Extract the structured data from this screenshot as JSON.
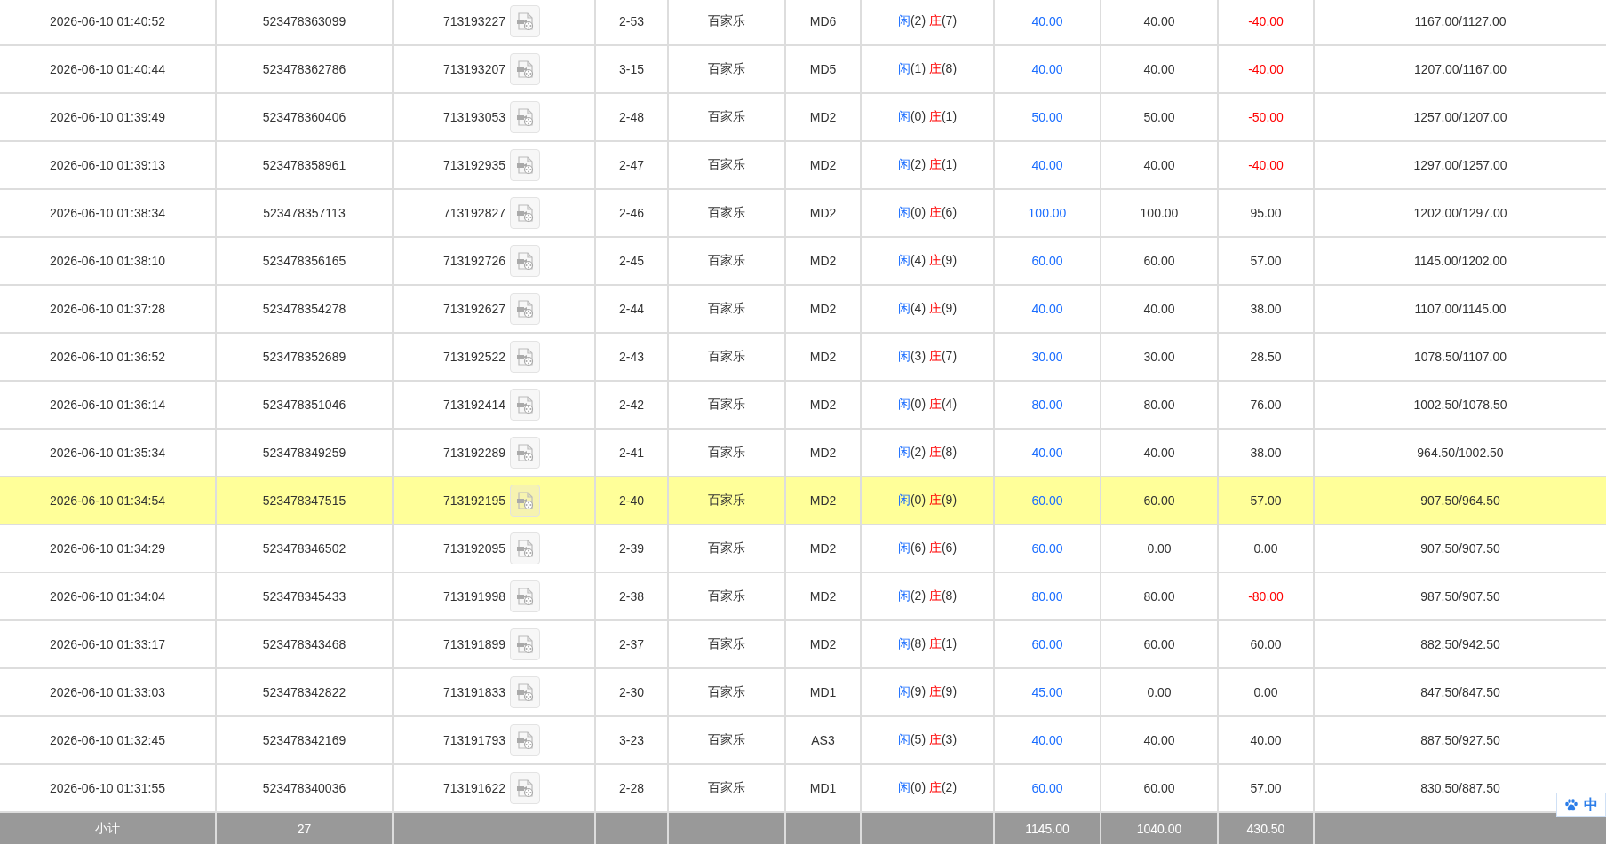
{
  "table": {
    "rows": [
      {
        "selected": false,
        "column_1": "2026-06-10 01:40:52",
        "column_2": "523478363099",
        "column_3": "713193227",
        "column_4": "2-53",
        "column_5": "百家乐",
        "column_6": "MD6",
        "column_7": {
          "player": "闲",
          "player_points": "(2)",
          "banker": "庄",
          "banker_points": "(7)"
        },
        "column_8": "40.00",
        "column_9": "40.00",
        "column_10": "-40.00",
        "column_10_negative": true,
        "column_11": "1167.00/1127.00"
      },
      {
        "selected": false,
        "column_1": "2026-06-10 01:40:44",
        "column_2": "523478362786",
        "column_3": "713193207",
        "column_4": "3-15",
        "column_5": "百家乐",
        "column_6": "MD5",
        "column_7": {
          "player": "闲",
          "player_points": "(1)",
          "banker": "庄",
          "banker_points": "(8)"
        },
        "column_8": "40.00",
        "column_9": "40.00",
        "column_10": "-40.00",
        "column_10_negative": true,
        "column_11": "1207.00/1167.00"
      },
      {
        "selected": false,
        "column_1": "2026-06-10 01:39:49",
        "column_2": "523478360406",
        "column_3": "713193053",
        "column_4": "2-48",
        "column_5": "百家乐",
        "column_6": "MD2",
        "column_7": {
          "player": "闲",
          "player_points": "(0)",
          "banker": "庄",
          "banker_points": "(1)"
        },
        "column_8": "50.00",
        "column_9": "50.00",
        "column_10": "-50.00",
        "column_10_negative": true,
        "column_11": "1257.00/1207.00"
      },
      {
        "selected": false,
        "column_1": "2026-06-10 01:39:13",
        "column_2": "523478358961",
        "column_3": "713192935",
        "column_4": "2-47",
        "column_5": "百家乐",
        "column_6": "MD2",
        "column_7": {
          "player": "闲",
          "player_points": "(2)",
          "banker": "庄",
          "banker_points": "(1)"
        },
        "column_8": "40.00",
        "column_9": "40.00",
        "column_10": "-40.00",
        "column_10_negative": true,
        "column_11": "1297.00/1257.00"
      },
      {
        "selected": false,
        "column_1": "2026-06-10 01:38:34",
        "column_2": "523478357113",
        "column_3": "713192827",
        "column_4": "2-46",
        "column_5": "百家乐",
        "column_6": "MD2",
        "column_7": {
          "player": "闲",
          "player_points": "(0)",
          "banker": "庄",
          "banker_points": "(6)"
        },
        "column_8": "100.00",
        "column_9": "100.00",
        "column_10": "95.00",
        "column_10_negative": false,
        "column_11": "1202.00/1297.00"
      },
      {
        "selected": false,
        "column_1": "2026-06-10 01:38:10",
        "column_2": "523478356165",
        "column_3": "713192726",
        "column_4": "2-45",
        "column_5": "百家乐",
        "column_6": "MD2",
        "column_7": {
          "player": "闲",
          "player_points": "(4)",
          "banker": "庄",
          "banker_points": "(9)"
        },
        "column_8": "60.00",
        "column_9": "60.00",
        "column_10": "57.00",
        "column_10_negative": false,
        "column_11": "1145.00/1202.00"
      },
      {
        "selected": false,
        "column_1": "2026-06-10 01:37:28",
        "column_2": "523478354278",
        "column_3": "713192627",
        "column_4": "2-44",
        "column_5": "百家乐",
        "column_6": "MD2",
        "column_7": {
          "player": "闲",
          "player_points": "(4)",
          "banker": "庄",
          "banker_points": "(9)"
        },
        "column_8": "40.00",
        "column_9": "40.00",
        "column_10": "38.00",
        "column_10_negative": false,
        "column_11": "1107.00/1145.00"
      },
      {
        "selected": false,
        "column_1": "2026-06-10 01:36:52",
        "column_2": "523478352689",
        "column_3": "713192522",
        "column_4": "2-43",
        "column_5": "百家乐",
        "column_6": "MD2",
        "column_7": {
          "player": "闲",
          "player_points": "(3)",
          "banker": "庄",
          "banker_points": "(7)"
        },
        "column_8": "30.00",
        "column_9": "30.00",
        "column_10": "28.50",
        "column_10_negative": false,
        "column_11": "1078.50/1107.00"
      },
      {
        "selected": false,
        "column_1": "2026-06-10 01:36:14",
        "column_2": "523478351046",
        "column_3": "713192414",
        "column_4": "2-42",
        "column_5": "百家乐",
        "column_6": "MD2",
        "column_7": {
          "player": "闲",
          "player_points": "(0)",
          "banker": "庄",
          "banker_points": "(4)"
        },
        "column_8": "80.00",
        "column_9": "80.00",
        "column_10": "76.00",
        "column_10_negative": false,
        "column_11": "1002.50/1078.50"
      },
      {
        "selected": false,
        "column_1": "2026-06-10 01:35:34",
        "column_2": "523478349259",
        "column_3": "713192289",
        "column_4": "2-41",
        "column_5": "百家乐",
        "column_6": "MD2",
        "column_7": {
          "player": "闲",
          "player_points": "(2)",
          "banker": "庄",
          "banker_points": "(8)"
        },
        "column_8": "40.00",
        "column_9": "40.00",
        "column_10": "38.00",
        "column_10_negative": false,
        "column_11": "964.50/1002.50"
      },
      {
        "selected": true,
        "column_1": "2026-06-10 01:34:54",
        "column_2": "523478347515",
        "column_3": "713192195",
        "column_4": "2-40",
        "column_5": "百家乐",
        "column_6": "MD2",
        "column_7": {
          "player": "闲",
          "player_points": "(0)",
          "banker": "庄",
          "banker_points": "(9)"
        },
        "column_8": "60.00",
        "column_9": "60.00",
        "column_10": "57.00",
        "column_10_negative": false,
        "column_11": "907.50/964.50"
      },
      {
        "selected": false,
        "column_1": "2026-06-10 01:34:29",
        "column_2": "523478346502",
        "column_3": "713192095",
        "column_4": "2-39",
        "column_5": "百家乐",
        "column_6": "MD2",
        "column_7": {
          "player": "闲",
          "player_points": "(6)",
          "banker": "庄",
          "banker_points": "(6)"
        },
        "column_8": "60.00",
        "column_9": "0.00",
        "column_10": "0.00",
        "column_10_negative": false,
        "column_11": "907.50/907.50"
      },
      {
        "selected": false,
        "column_1": "2026-06-10 01:34:04",
        "column_2": "523478345433",
        "column_3": "713191998",
        "column_4": "2-38",
        "column_5": "百家乐",
        "column_6": "MD2",
        "column_7": {
          "player": "闲",
          "player_points": "(2)",
          "banker": "庄",
          "banker_points": "(8)"
        },
        "column_8": "80.00",
        "column_9": "80.00",
        "column_10": "-80.00",
        "column_10_negative": true,
        "column_11": "987.50/907.50"
      },
      {
        "selected": false,
        "column_1": "2026-06-10 01:33:17",
        "column_2": "523478343468",
        "column_3": "713191899",
        "column_4": "2-37",
        "column_5": "百家乐",
        "column_6": "MD2",
        "column_7": {
          "player": "闲",
          "player_points": "(8)",
          "banker": "庄",
          "banker_points": "(1)"
        },
        "column_8": "60.00",
        "column_9": "60.00",
        "column_10": "60.00",
        "column_10_negative": false,
        "column_11": "882.50/942.50"
      },
      {
        "selected": false,
        "column_1": "2026-06-10 01:33:03",
        "column_2": "523478342822",
        "column_3": "713191833",
        "column_4": "2-30",
        "column_5": "百家乐",
        "column_6": "MD1",
        "column_7": {
          "player": "闲",
          "player_points": "(9)",
          "banker": "庄",
          "banker_points": "(9)"
        },
        "column_8": "45.00",
        "column_9": "0.00",
        "column_10": "0.00",
        "column_10_negative": false,
        "column_11": "847.50/847.50"
      },
      {
        "selected": false,
        "column_1": "2026-06-10 01:32:45",
        "column_2": "523478342169",
        "column_3": "713191793",
        "column_4": "3-23",
        "column_5": "百家乐",
        "column_6": "AS3",
        "column_7": {
          "player": "闲",
          "player_points": "(5)",
          "banker": "庄",
          "banker_points": "(3)"
        },
        "column_8": "40.00",
        "column_9": "40.00",
        "column_10": "40.00",
        "column_10_negative": false,
        "column_11": "887.50/927.50"
      },
      {
        "selected": false,
        "column_1": "2026-06-10 01:31:55",
        "column_2": "523478340036",
        "column_3": "713191622",
        "column_4": "2-28",
        "column_5": "百家乐",
        "column_6": "MD1",
        "column_7": {
          "player": "闲",
          "player_points": "(0)",
          "banker": "庄",
          "banker_points": "(2)"
        },
        "column_8": "60.00",
        "column_9": "60.00",
        "column_10": "57.00",
        "column_10_negative": false,
        "column_11": "830.50/887.50"
      }
    ],
    "footer": {
      "column_1": "小计",
      "column_2": "27",
      "column_8": "1145.00",
      "column_9": "1040.00",
      "column_10": "430.50"
    }
  },
  "ime_badge": {
    "label": "中"
  }
}
